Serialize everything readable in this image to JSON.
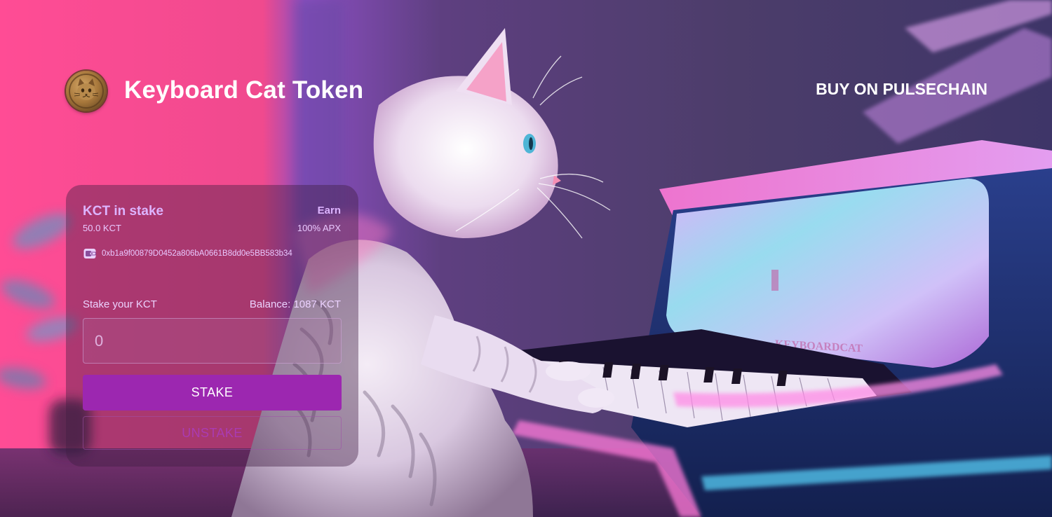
{
  "header": {
    "brand_name": "Keyboard Cat Token",
    "logo_icon": "cat-coin-icon",
    "buy_link": "BUY ON PULSECHAIN"
  },
  "stake_card": {
    "title": "KCT in stake",
    "staked_amount": "50.0 KCT",
    "earn_label": "Earn",
    "earn_rate": "100% APX",
    "wallet_icon": "wallet-icon",
    "wallet_address": "0xb1a9f00879D0452a806bA0661B8dd0e5BB583b34",
    "stake_label": "Stake your KCT",
    "balance": "Balance: 1087 KCT",
    "input": {
      "value": "",
      "placeholder": "0"
    },
    "stake_button": "STAKE",
    "unstake_button": "UNSTAKE"
  },
  "colors": {
    "accent": "#9c27b0",
    "card_title": "#ddb4ff",
    "header_text": "#ffffff"
  }
}
